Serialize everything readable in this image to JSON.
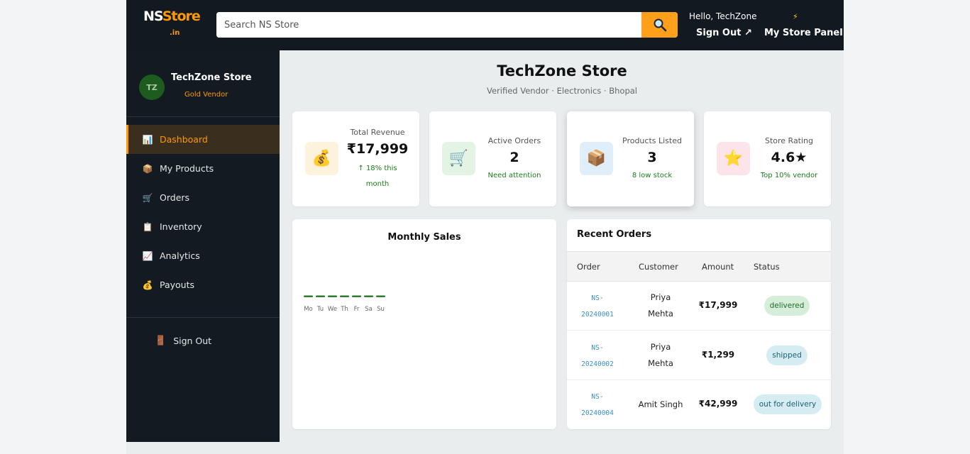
{
  "header": {
    "logo_ns": "NS",
    "logo_store": "Store",
    "logo_tld": ".in",
    "search_placeholder": "Search NS Store",
    "search_icon": "magnifier-icon",
    "greeting": "Hello, TechZone",
    "sign_out": "Sign Out ↗",
    "panel_icon": "⚡",
    "panel_link": "My Store Panel"
  },
  "sidebar": {
    "avatar_initials": "TZ",
    "store_name": "TechZone Store",
    "vendor_tier": "Gold Vendor",
    "items": [
      {
        "icon": "📊",
        "label": "Dashboard",
        "active": true
      },
      {
        "icon": "📦",
        "label": "My Products"
      },
      {
        "icon": "🛒",
        "label": "Orders"
      },
      {
        "icon": "📋",
        "label": "Inventory"
      },
      {
        "icon": "📈",
        "label": "Analytics"
      },
      {
        "icon": "💰",
        "label": "Payouts"
      }
    ],
    "sign_out_icon": "🚪",
    "sign_out": "Sign Out"
  },
  "main": {
    "title": "TechZone Store",
    "subtitle": "Verified Vendor · Electronics · Bhopal"
  },
  "stats": [
    {
      "icon": "💰",
      "label": "Total Revenue",
      "value": "₹17,999",
      "note_line1": "↑ 18% this",
      "note_line2": "month",
      "bg": "#fdf3dc"
    },
    {
      "icon": "🛒",
      "label": "Active Orders",
      "value": "2",
      "note": "Need attention",
      "bg": "#e3f4e4"
    },
    {
      "icon": "📦",
      "label": "Products Listed",
      "value": "3",
      "note": "8 low stock",
      "bg": "#e0eefa"
    },
    {
      "icon": "⭐",
      "label": "Store Rating",
      "value": "4.6★",
      "note": "Top 10% vendor",
      "bg": "#fde4ea"
    }
  ],
  "chart": {
    "title": "Monthly Sales"
  },
  "chart_data": {
    "type": "bar",
    "title": "Monthly Sales",
    "categories": [
      "Mo",
      "Tu",
      "We",
      "Th",
      "Fr",
      "Sa",
      "Su"
    ],
    "values": [
      0,
      0,
      0,
      0,
      0,
      0,
      0
    ],
    "color": "#2e7d32"
  },
  "orders": {
    "title": "Recent Orders",
    "columns": [
      "Order",
      "Customer",
      "Amount",
      "Status"
    ],
    "rows": [
      {
        "order_l1": "NS-",
        "order_l2": "20240001",
        "cust_l1": "Priya",
        "cust_l2": "Mehta",
        "amount": "₹17,999",
        "status": "delivered"
      },
      {
        "order_l1": "NS-",
        "order_l2": "20240002",
        "cust_l1": "Priya",
        "cust_l2": "Mehta",
        "amount": "₹1,299",
        "status": "shipped"
      },
      {
        "order_l1": "NS-",
        "order_l2": "20240004",
        "cust_l1": "Amit Singh",
        "cust_l2": "",
        "amount": "₹42,999",
        "status": "out for delivery"
      }
    ]
  }
}
